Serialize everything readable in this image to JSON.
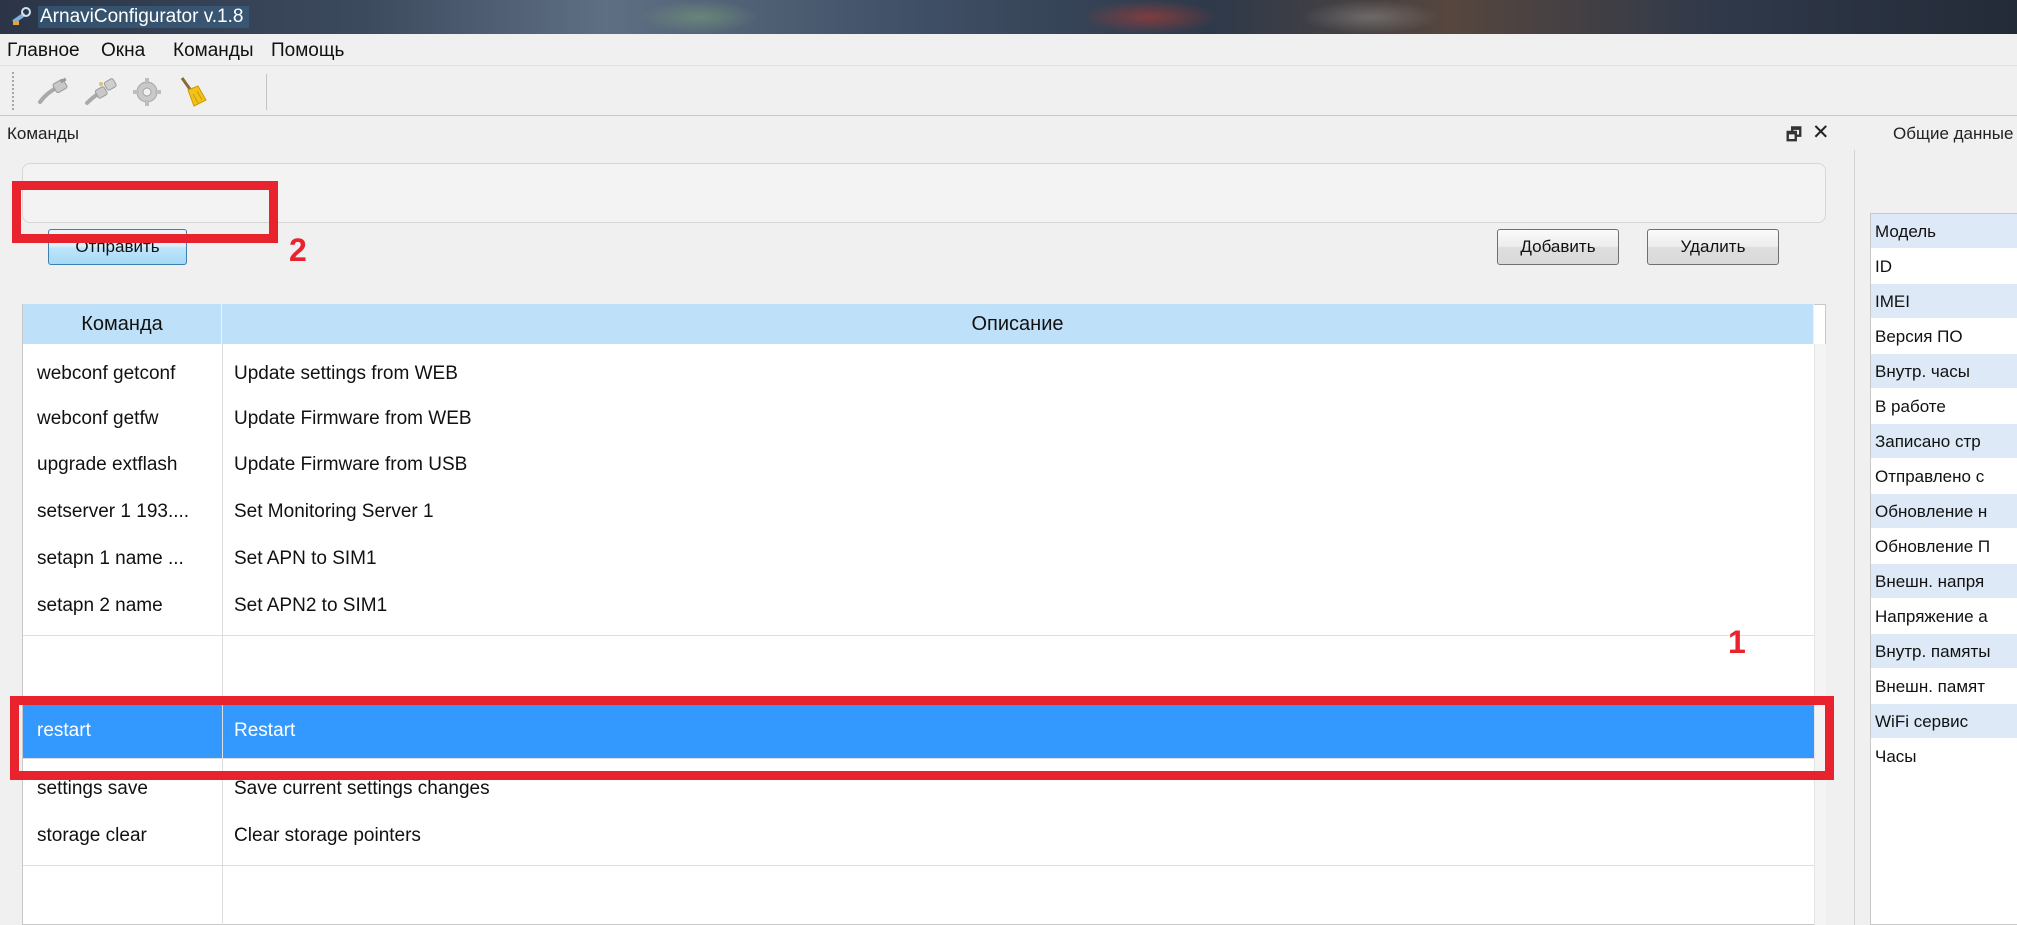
{
  "window": {
    "title": "ArnaviConfigurator v.1.8"
  },
  "menu": {
    "items": [
      "Главное",
      "Окна",
      "Команды",
      "Помощь"
    ]
  },
  "toolbar": {
    "icons": [
      "connect-cable-icon",
      "disconnect-cable-icon",
      "settings-gear-icon",
      "broom-clear-icon"
    ]
  },
  "commands_panel": {
    "title": "Команды",
    "send_label": "Отправить",
    "add_label": "Добавить",
    "delete_label": "Удалить",
    "table": {
      "headers": [
        "Команда",
        "Описание"
      ],
      "rows": [
        {
          "command": "webconf getconf",
          "description": "Update settings from WEB"
        },
        {
          "command": "webconf getfw",
          "description": "Update Firmware from WEB"
        },
        {
          "command": "upgrade extflash",
          "description": "Update Firmware from USB"
        },
        {
          "command": "setserver 1 193....",
          "description": "Set Monitoring Server 1"
        },
        {
          "command": "setapn 1 name ...",
          "description": "Set APN to SIM1"
        },
        {
          "command": "setapn 2 name",
          "description": "Set APN2 to SIM1"
        },
        {
          "command": "restart",
          "description": "Restart",
          "selected": true
        },
        {
          "command": "settings save",
          "description": "Save current settings changes"
        },
        {
          "command": "storage clear",
          "description": "Clear storage pointers"
        }
      ]
    }
  },
  "general_panel": {
    "title": "Общие данные",
    "rows": [
      "Модель",
      "ID",
      "IMEI",
      "Версия ПО",
      "Внутр. часы",
      "В работе",
      "Записано стр",
      "Отправлено с",
      "Обновление н",
      "Обновление П",
      "Внешн. напря",
      "Напряжение а",
      "Внутр. памяты",
      "Внешн. памят",
      "WiFi сервис",
      "Часы"
    ]
  },
  "annotations": {
    "label_1": "1",
    "label_2": "2",
    "color": "#e8232e"
  },
  "colors": {
    "selection": "#3399ff",
    "table_header": "#bfe0f9",
    "alt_row": "#dde9f6"
  }
}
